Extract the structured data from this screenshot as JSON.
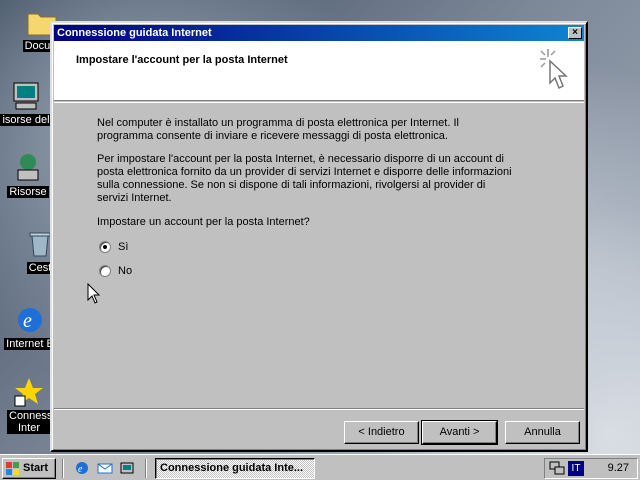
{
  "desktop": {
    "icons": [
      {
        "label": "Docum"
      },
      {
        "label": "isorse del"
      },
      {
        "label": "Risorse"
      },
      {
        "label": "Cest"
      },
      {
        "label": "Internet E"
      },
      {
        "label": "Conness Inter"
      }
    ]
  },
  "window": {
    "title": "Connessione guidata Internet",
    "close_label": "×",
    "header_title": "Impostare l'account per la posta Internet",
    "para1": "Nel computer è installato un programma di posta elettronica per Internet. Il programma consente di inviare e ricevere messaggi di posta elettronica.",
    "para2": "Per impostare l'account per la posta Internet, è necessario disporre di un account di posta elettronica fornito da un provider di servizi Internet e disporre delle informazioni sulla connessione. Se non si dispone di tali informazioni, rivolgersi al provider di servizi Internet.",
    "question": "Impostare un account per la posta Internet?",
    "options": [
      {
        "label": "Sì",
        "checked": true
      },
      {
        "label": "No",
        "checked": false
      }
    ],
    "buttons": {
      "back": "< Indietro",
      "next": "Avanti >",
      "cancel": "Annulla"
    }
  },
  "taskbar": {
    "start_label": "Start",
    "task_label": "Connessione guidata Inte...",
    "tray_lang": "IT",
    "clock": "9.27"
  }
}
